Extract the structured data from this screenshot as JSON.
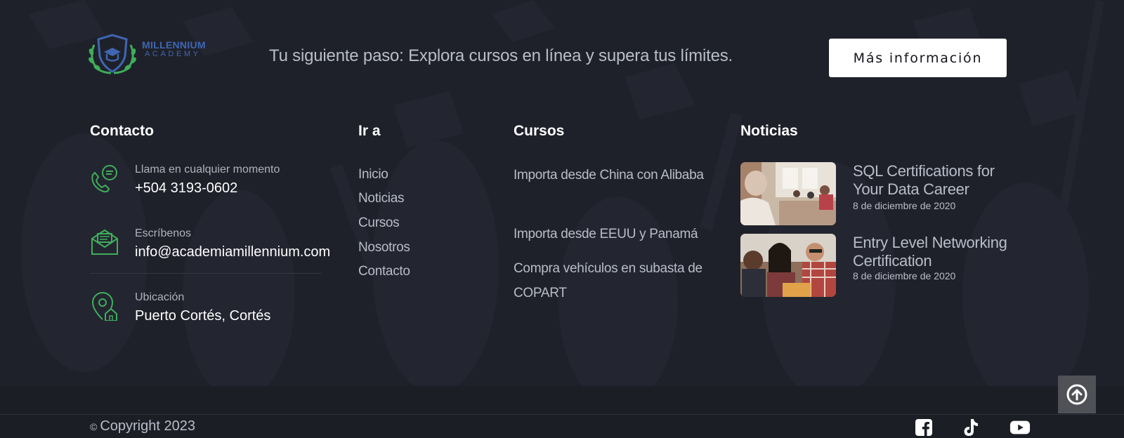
{
  "brand": {
    "logo_line1": "MILLENNIUM",
    "logo_line2": "ACADEMY",
    "logo_color": "#3f66b3",
    "laurel_color": "#3fae5a"
  },
  "header": {
    "tagline": "Tu siguiente paso: Explora cursos en línea y supera tus límites.",
    "cta_label": "Más información"
  },
  "contact": {
    "title": "Contacto",
    "items": [
      {
        "icon": "phone-chat-icon",
        "label": "Llama en cualquier momento",
        "value": "+504 3193-0602"
      },
      {
        "icon": "mail-icon",
        "label": "Escríbenos",
        "value": "info@academiamillennium.com"
      },
      {
        "icon": "location-home-icon",
        "label": "Ubicación",
        "value": "Puerto Cortés, Cortés"
      }
    ],
    "icon_color": "#3fae5a"
  },
  "nav": {
    "title": "Ir a",
    "links": [
      "Inicio",
      "Noticias",
      "Cursos",
      "Nosotros",
      "Contacto"
    ]
  },
  "courses": {
    "title": "Cursos",
    "links": [
      "Importa desde China con Alibaba",
      "Importa desde EEUU y Panamá",
      "Compra vehículos en subasta de COPART"
    ]
  },
  "news": {
    "title": "Noticias",
    "items": [
      {
        "title": "SQL Certifications for Your Data Career",
        "date": "8 de diciembre de 2020"
      },
      {
        "title": "Entry Level Networking Certification",
        "date": "8 de diciembre de 2020"
      }
    ]
  },
  "footer": {
    "copyright_symbol": "©",
    "copyright": "Copyright 2023",
    "social_icons": [
      "facebook-icon",
      "tiktok-icon",
      "youtube-icon"
    ],
    "back_to_top_icon": "arrow-up-circle-icon"
  }
}
